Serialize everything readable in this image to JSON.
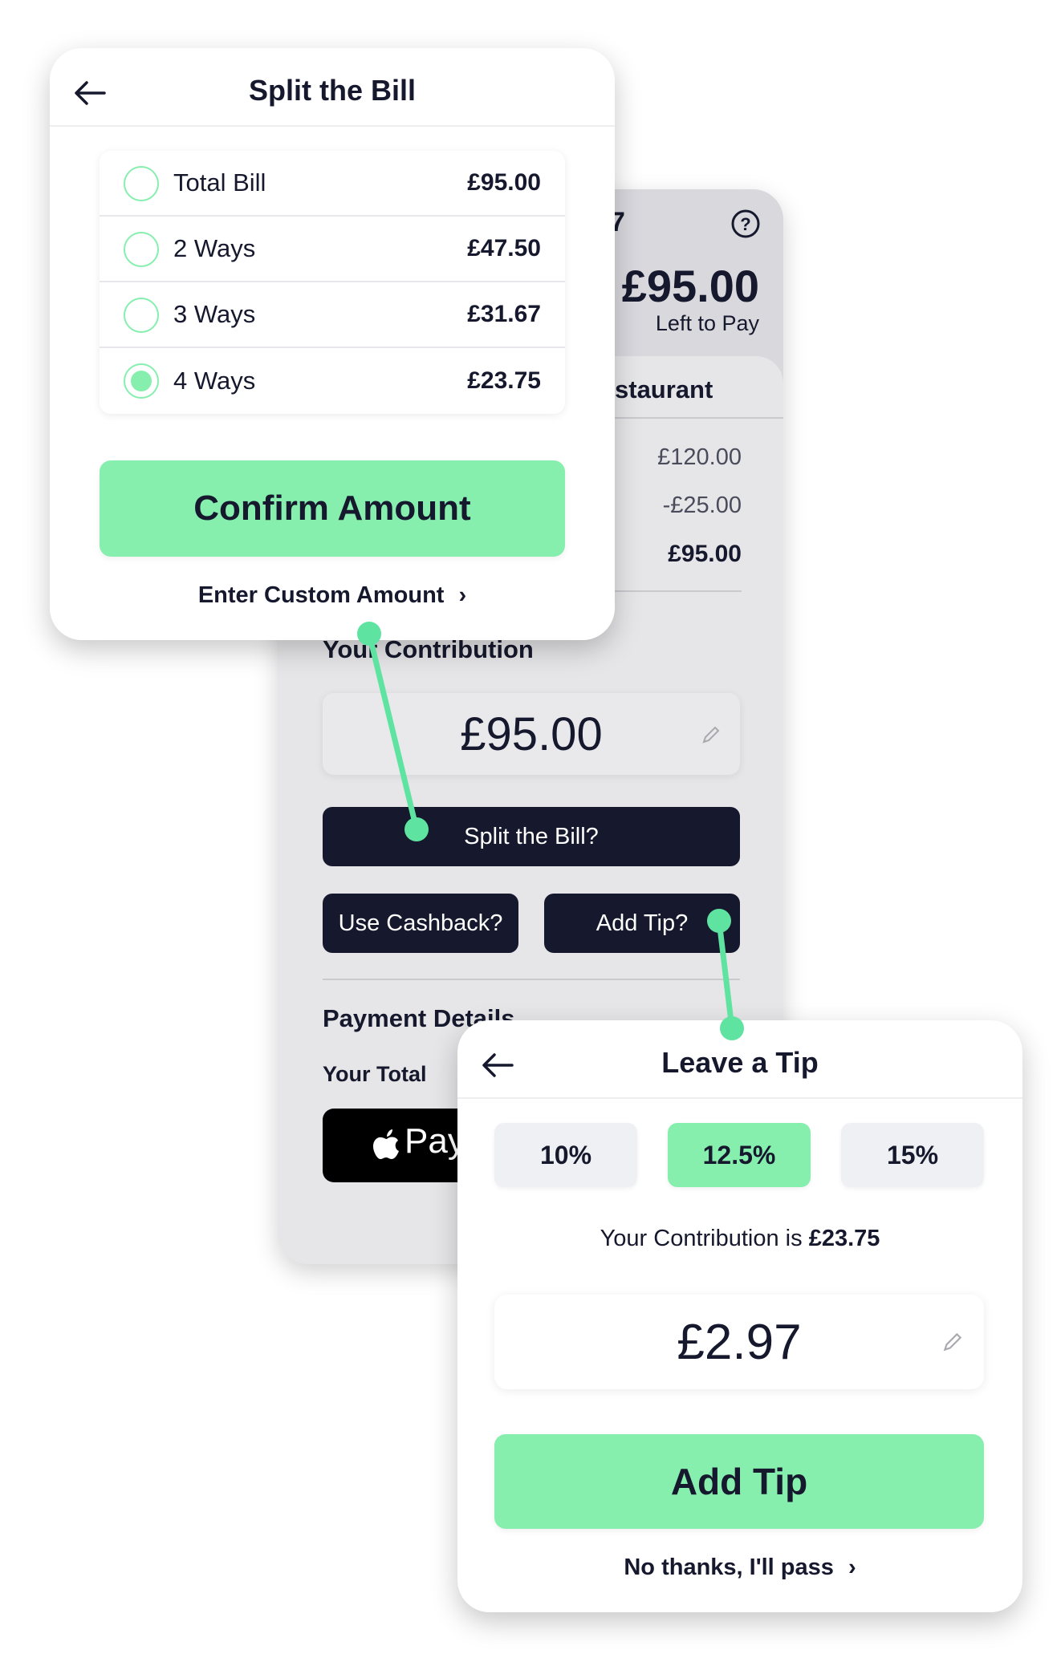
{
  "main_screen": {
    "table_number_partial": "7",
    "help_icon": "question-circle-icon",
    "left_to_pay_amount": "£95.00",
    "left_to_pay_label": "Left to Pay",
    "restaurant_partial": "staurant",
    "bill_lines": [
      "£120.00",
      "-£25.00",
      "£95.00"
    ],
    "contribution_label": "Your Contribution",
    "contribution_amount": "£95.00",
    "split_button": "Split the Bill?",
    "cashback_button": "Use Cashback?",
    "tip_button": "Add Tip?",
    "payment_details_label": "Payment Details",
    "your_total_label": "Your Total",
    "apple_pay_label": "Pay"
  },
  "split_modal": {
    "title": "Split the Bill",
    "options": [
      {
        "label": "Total Bill",
        "value": "£95.00",
        "selected": false
      },
      {
        "label": "2 Ways",
        "value": "£47.50",
        "selected": false
      },
      {
        "label": "3 Ways",
        "value": "£31.67",
        "selected": false
      },
      {
        "label": "4 Ways",
        "value": "£23.75",
        "selected": true
      }
    ],
    "confirm_button": "Confirm Amount",
    "custom_link": "Enter Custom Amount"
  },
  "tip_modal": {
    "title": "Leave a Tip",
    "percentages": [
      {
        "label": "10%",
        "selected": false
      },
      {
        "label": "12.5%",
        "selected": true
      },
      {
        "label": "15%",
        "selected": false
      }
    ],
    "contribution_text": "Your Contribution is ",
    "contribution_value": "£23.75",
    "tip_amount": "£2.97",
    "add_button": "Add Tip",
    "pass_link": "No thanks, I'll pass"
  },
  "colors": {
    "accent_green": "#86efae",
    "dark_navy": "#16192d",
    "connector": "#5fe3a0"
  }
}
